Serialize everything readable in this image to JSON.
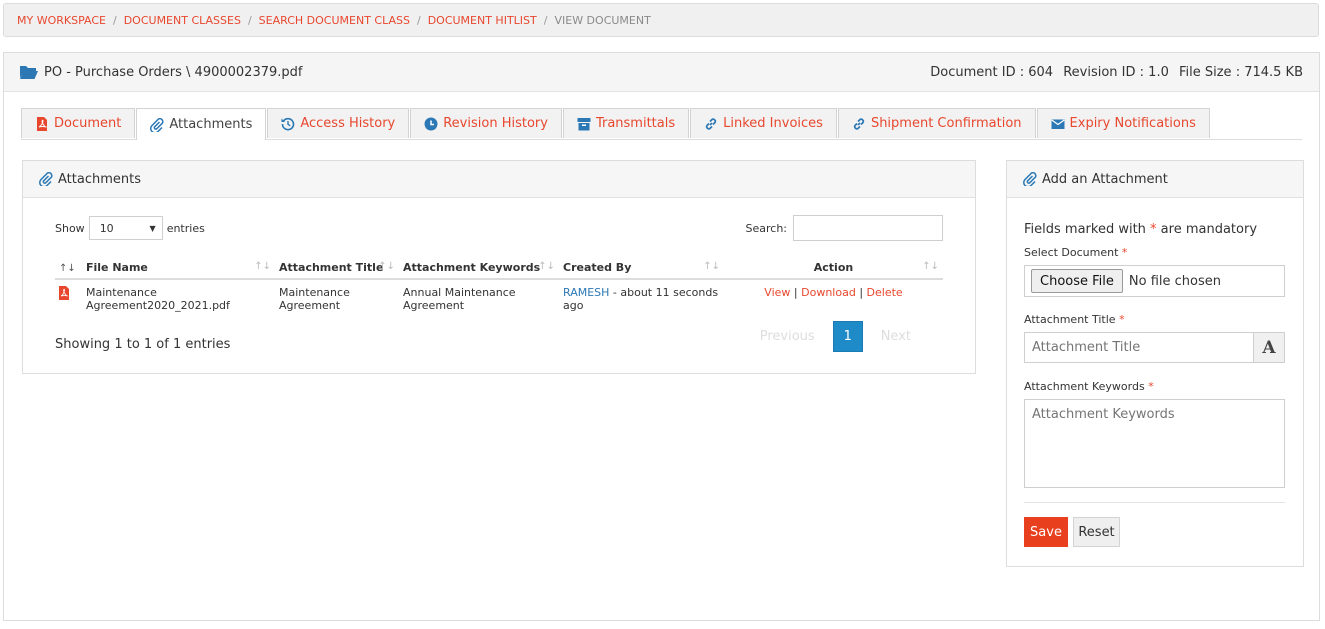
{
  "breadcrumb": [
    "MY WORKSPACE",
    "DOCUMENT CLASSES",
    "SEARCH DOCUMENT CLASS",
    "DOCUMENT HITLIST",
    "VIEW DOCUMENT"
  ],
  "breadcrumb_sep": "/",
  "document": {
    "title": "PO - Purchase Orders \\ 4900002379.pdf",
    "id": "Document ID : 604",
    "revision": "Revision ID : 1.0",
    "size": "File Size : 714.5 KB"
  },
  "tabs": [
    {
      "label": "Document",
      "icon": "pdf-icon"
    },
    {
      "label": "Attachments",
      "icon": "paperclip-icon"
    },
    {
      "label": "Access History",
      "icon": "history-icon"
    },
    {
      "label": "Revision History",
      "icon": "clock-icon"
    },
    {
      "label": "Transmittals",
      "icon": "box-icon"
    },
    {
      "label": "Linked Invoices",
      "icon": "link-icon"
    },
    {
      "label": "Shipment Confirmation",
      "icon": "link-icon"
    },
    {
      "label": "Expiry Notifications",
      "icon": "envelope-icon"
    }
  ],
  "attachments": {
    "heading": "Attachments",
    "show_label": "Show",
    "page_size": "10",
    "entries_label": "entries",
    "search_label": "Search:",
    "columns": [
      "File Name",
      "Attachment Title",
      "Attachment Keywords",
      "Created By",
      "Action"
    ],
    "rows": [
      {
        "file_name_1": "Maintenance",
        "file_name_2": "Agreement2020_2021.pdf",
        "title_1": "Maintenance",
        "title_2": "Agreement",
        "keywords_1": "Annual Maintenance",
        "keywords_2": "Agreement",
        "created_user": "RAMESH",
        "created_rest": " - about 11 seconds",
        "created_rest_2": "ago",
        "action_view": "View",
        "action_download": "Download",
        "action_delete": "Delete",
        "action_sep": "|"
      }
    ],
    "info": "Showing 1 to 1 of 1 entries",
    "prev": "Previous",
    "page": "1",
    "next": "Next"
  },
  "add_form": {
    "heading": "Add an Attachment",
    "mandatory_pre": "Fields marked with ",
    "mandatory_star": "*",
    "mandatory_post": " are mandatory",
    "select_label": "Select Document",
    "choose_file": "Choose File",
    "no_file": "No file chosen",
    "title_label": "Attachment Title",
    "title_placeholder": "Attachment Title",
    "title_addon": "A",
    "keywords_label": "Attachment Keywords",
    "keywords_placeholder": "Attachment Keywords",
    "req_star": "*",
    "save": "Save",
    "reset": "Reset"
  },
  "colors": {
    "accent": "#e8472e",
    "link_blue": "#2b78b4",
    "page_active": "#1e8ac7",
    "save_button": "#e8401f"
  }
}
